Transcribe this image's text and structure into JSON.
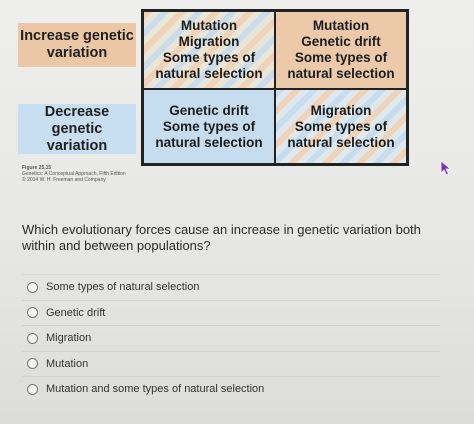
{
  "figure": {
    "row_labels": {
      "increase": "Increase genetic\nvariation",
      "decrease": "Decrease genetic\nvariation"
    },
    "cells": {
      "top_left": [
        "Mutation",
        "Migration",
        "Some types of",
        "natural selection"
      ],
      "top_right": [
        "Mutation",
        "Genetic drift",
        "Some types of",
        "natural selection"
      ],
      "bottom_left": [
        "Genetic drift",
        "Some types of",
        "natural selection"
      ],
      "bottom_right": [
        "Migration",
        "Some types of",
        "natural selection"
      ]
    },
    "caption": {
      "figure_number": "Figure 25.15",
      "book": "Genetics: A Conceptual Approach, Fifth Edition",
      "copyright": "© 2014 W. H. Freeman and Company"
    }
  },
  "question": "Which evolutionary forces cause an increase in genetic variation both within and between populations?",
  "options": [
    "Some types of natural selection",
    "Genetic drift",
    "Migration",
    "Mutation",
    "Mutation and some types of natural selection"
  ]
}
